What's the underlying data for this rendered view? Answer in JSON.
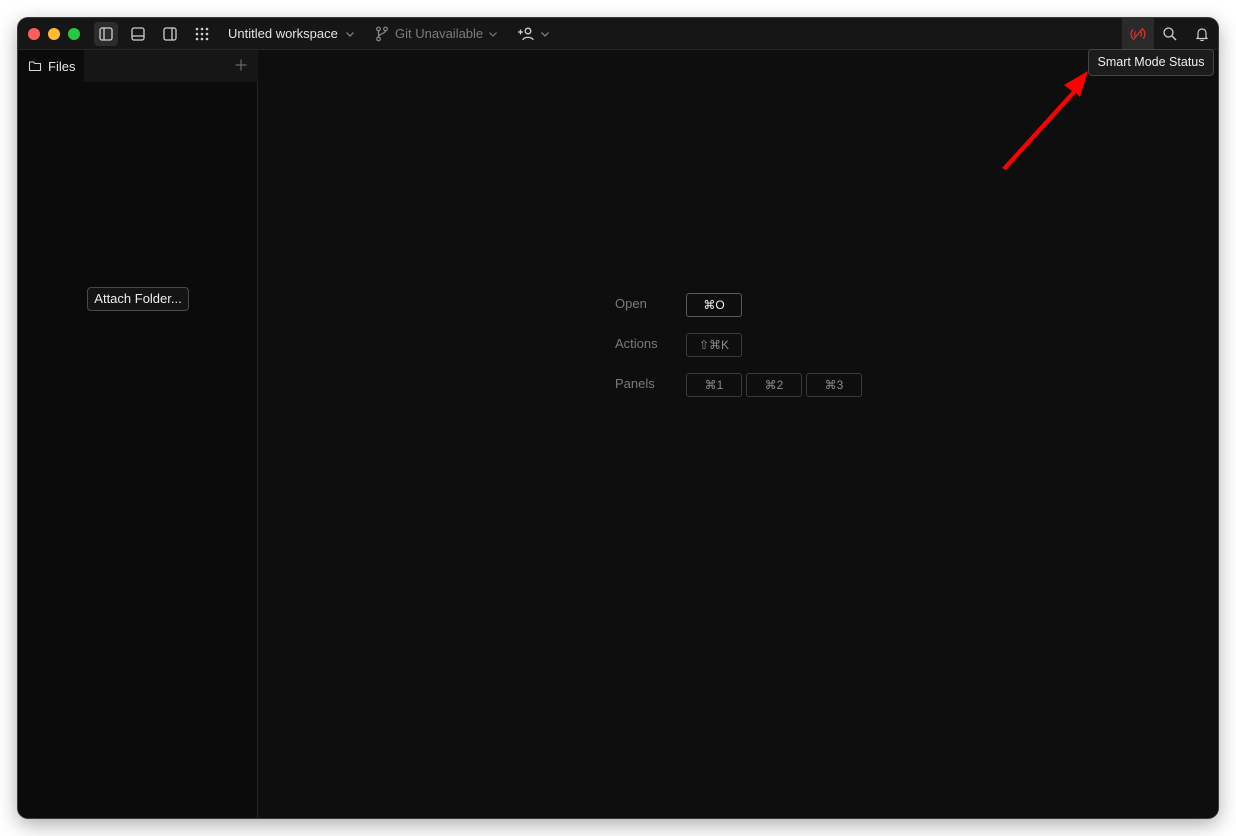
{
  "titlebar": {
    "workspace_name": "Untitled workspace",
    "git_label": "Git Unavailable",
    "icons": [
      "sidebar-left-icon",
      "panel-bottom-icon",
      "sidebar-right-icon",
      "grid-dots-icon",
      "git-branch-icon",
      "add-user-icon",
      "smart-mode-icon",
      "search-icon",
      "bell-icon"
    ]
  },
  "sidebar": {
    "tab_label": "Files",
    "attach_label": "Attach Folder..."
  },
  "shortcuts": {
    "open_label": "Open",
    "open_key": "⌘O",
    "actions_label": "Actions",
    "actions_key": "⇧⌘K",
    "panels_label": "Panels",
    "panel_keys": [
      "⌘1",
      "⌘2",
      "⌘3"
    ]
  },
  "tooltip": {
    "text": "Smart Mode Status"
  },
  "colors": {
    "accent_red": "#e0312f",
    "background": "#0e0e0e",
    "annotation_arrow": "#ff0000"
  }
}
